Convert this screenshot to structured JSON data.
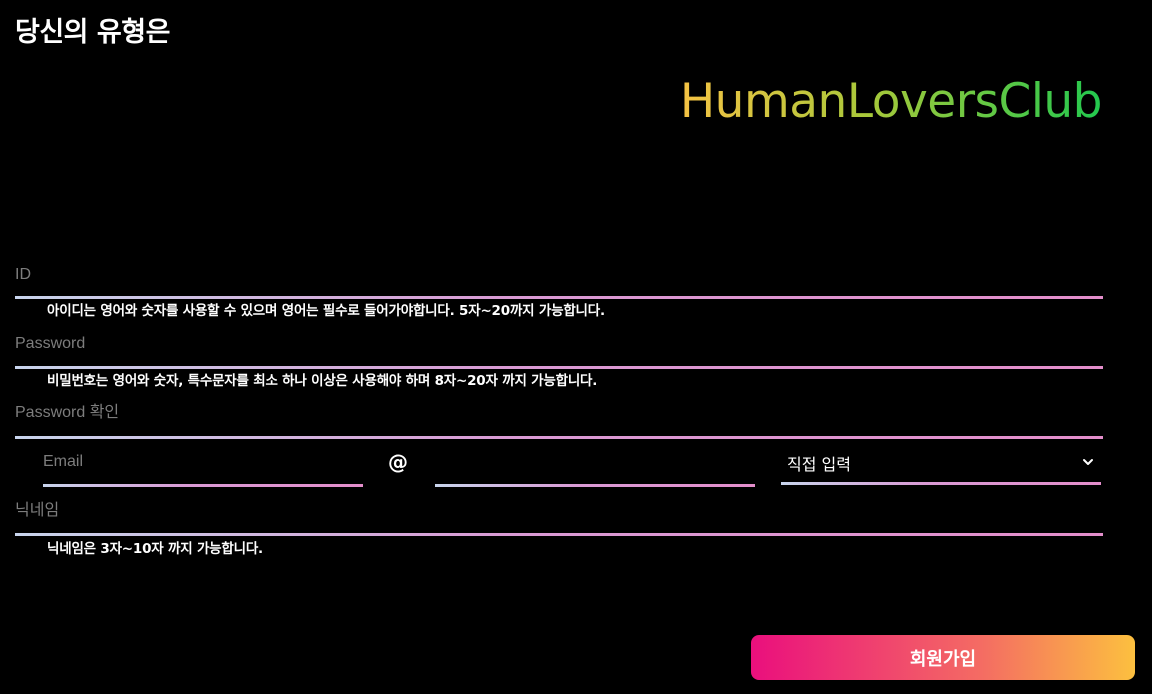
{
  "header": {
    "title": "당신의 유형은",
    "logo": "HumanLoversClub"
  },
  "form": {
    "id": {
      "placeholder": "ID",
      "value": "",
      "hint": "아이디는 영어와 숫자를 사용할 수 있으며 영어는 필수로 들어가야합니다. 5자~20까지 가능합니다."
    },
    "password": {
      "placeholder": "Password",
      "value": "",
      "hint": "비밀번호는 영어와 숫자, 특수문자를 최소 하나 이상은 사용해야 하며 8자~20자 까지 가능합니다."
    },
    "password_confirm": {
      "placeholder": "Password 확인",
      "value": ""
    },
    "email": {
      "local_placeholder": "Email",
      "local_value": "",
      "at": "@",
      "domain_value": "",
      "domain_select": "직접 입력",
      "chevron_icon": "chevron-down-icon"
    },
    "nickname": {
      "placeholder": "닉네임",
      "value": "",
      "hint": "닉네임은 3자~10자 까지 가능합니다."
    },
    "submit_label": "회원가입"
  },
  "colors": {
    "background": "#000000",
    "logo_gradient_start": "#f6c344",
    "logo_gradient_end": "#22c84e",
    "underline_start": "#c8d4ec",
    "underline_end": "#e38ecb",
    "button_gradient_start": "#ea0f7d",
    "button_gradient_end": "#fcc03f"
  }
}
